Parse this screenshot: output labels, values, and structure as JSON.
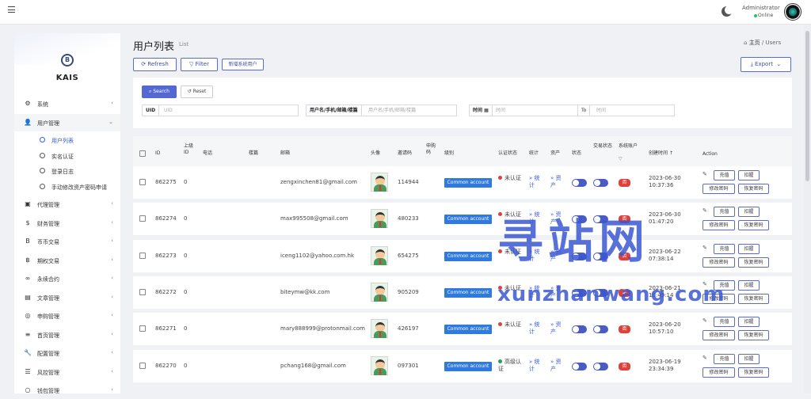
{
  "header": {
    "user_name": "Administrator",
    "user_status": "Online"
  },
  "sidebar": {
    "brand": "KAIS",
    "items": [
      {
        "label": "系统",
        "icon": "⚙"
      },
      {
        "label": "用户管理",
        "icon": "👤"
      },
      {
        "label": "代理管理",
        "icon": "▣"
      },
      {
        "label": "财务管理",
        "icon": "$"
      },
      {
        "label": "币币交易",
        "icon": "B"
      },
      {
        "label": "期权交易",
        "icon": "฿"
      },
      {
        "label": "永续合约",
        "icon": "∞"
      },
      {
        "label": "文章管理",
        "icon": "▤"
      },
      {
        "label": "申购管理",
        "icon": "◎"
      },
      {
        "label": "首页管理",
        "icon": "≡"
      },
      {
        "label": "配置管理",
        "icon": "🔧"
      },
      {
        "label": "风控管理",
        "icon": "☰"
      },
      {
        "label": "钱包管理",
        "icon": "○"
      }
    ],
    "subitems": [
      {
        "label": "用户列表"
      },
      {
        "label": "实名认证"
      },
      {
        "label": "登录日志"
      },
      {
        "label": "手动修改资产密码申请"
      }
    ]
  },
  "page": {
    "title": "用户列表",
    "subtitle": "List",
    "breadcrumb_home": "主页",
    "breadcrumb_sep": "/",
    "breadcrumb_current": "Users"
  },
  "toolbar": {
    "refresh": "Refresh",
    "filter": "Filter",
    "add_user": "新增系统用户",
    "export": "Export"
  },
  "filters": {
    "search": "Search",
    "reset": "Reset",
    "uid_label": "UID",
    "uid_placeholder": "UID",
    "user_label": "用户名/手机/邮箱/楼篇",
    "user_placeholder": "用户名/手机/邮箱/楼篇",
    "time_label": "时间",
    "time_placeholder": "时间",
    "to_label": "To",
    "to_placeholder": "时间"
  },
  "table": {
    "headers": {
      "id": "ID",
      "parent": "上级ID",
      "phone": "电话",
      "floor": "楼篇",
      "email": "邮箱",
      "avatar": "头像",
      "invite": "邀请码",
      "apply_code": "申购码",
      "level": "级别",
      "auth": "认证状态",
      "stats": "统计",
      "assets": "资产",
      "status": "状态",
      "trade_status": "交易状态",
      "sys_account": "系统账户",
      "created": "创建时间",
      "action": "Action"
    },
    "rows": [
      {
        "id": "862275",
        "parent": "0",
        "email": "zengxinchen81@gmail.com",
        "invite": "114944",
        "level": "Common account",
        "auth": "未认证",
        "auth_color": "#e0403b",
        "stats": "» 统计",
        "assets": "» 资产",
        "sys": "否",
        "date": "2023-06-30",
        "time": "10:37:36"
      },
      {
        "id": "862274",
        "parent": "0",
        "email": "max995508@gmail.com",
        "invite": "480233",
        "level": "Common account",
        "auth": "未认证",
        "auth_color": "#e0403b",
        "stats": "» 统计",
        "assets": "» 资产",
        "sys": "否",
        "date": "2023-06-30",
        "time": "01:47:20"
      },
      {
        "id": "862273",
        "parent": "0",
        "email": "iceng1102@yahoo.com.hk",
        "invite": "654275",
        "level": "Common account",
        "auth": "未认证",
        "auth_color": "#e0403b",
        "stats": "» 统计",
        "assets": "» 资产",
        "sys": "否",
        "date": "2023-06-22",
        "time": "07:38:14"
      },
      {
        "id": "862272",
        "parent": "0",
        "email": "biteymw@kk.com",
        "invite": "905209",
        "level": "Common account",
        "auth": "未认证",
        "auth_color": "#e0403b",
        "stats": "» 统计",
        "assets": "» 资产",
        "sys": "是",
        "date": "2023-06-21",
        "time": "10:49:14"
      },
      {
        "id": "862271",
        "parent": "0",
        "email": "mary888999@protonmail.com",
        "invite": "426197",
        "level": "Common account",
        "auth": "未认证",
        "auth_color": "#e0403b",
        "stats": "» 统计",
        "assets": "» 资产",
        "sys": "否",
        "date": "2023-06-20",
        "time": "10:57:10"
      },
      {
        "id": "862270",
        "parent": "0",
        "email": "pchang168@gmail.com",
        "invite": "097301",
        "level": "Common account",
        "auth": "高级认证",
        "auth_color": "#22a35a",
        "stats": "» 统计",
        "assets": "» 资产",
        "sys": "否",
        "date": "2023-06-19",
        "time": "23:34:39"
      }
    ],
    "action_buttons": {
      "recharge": "充值",
      "deduct": "扣握",
      "change_pwd": "修改密码",
      "reset_pwd": "恢复密码"
    }
  },
  "watermark": {
    "main": "寻站网",
    "sub": "xunzhanwang.com"
  }
}
